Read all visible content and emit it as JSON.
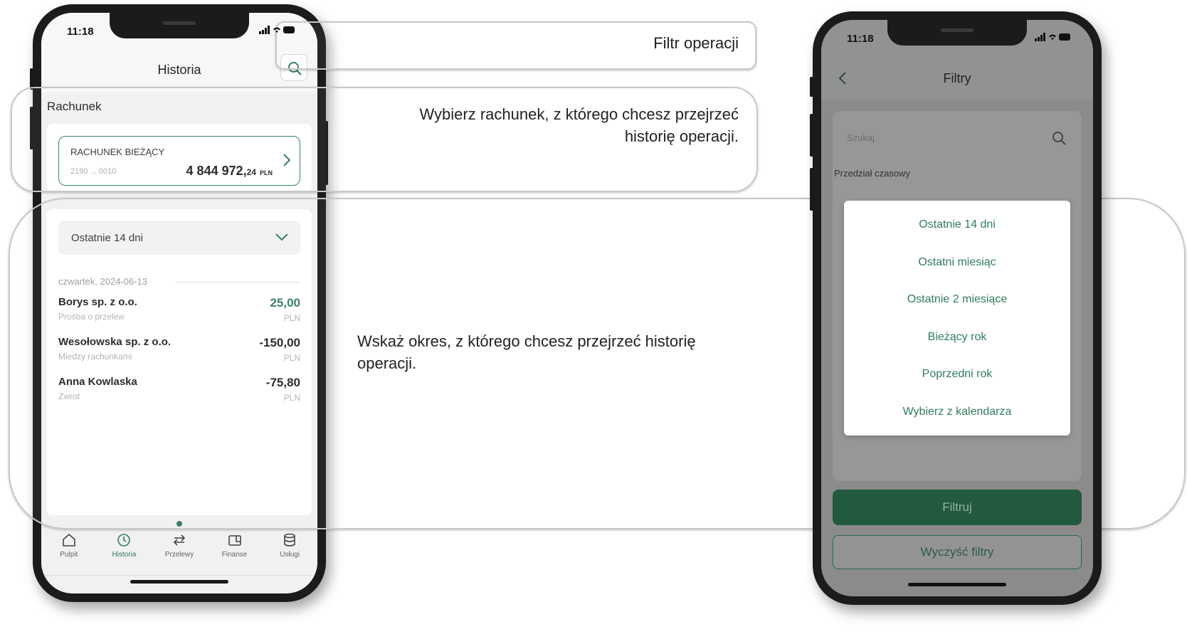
{
  "colors": {
    "brand_green": "#2e7d5b",
    "dark_green": "#225a3f",
    "overlay_gray": "#8b8b8b"
  },
  "left_phone": {
    "status_time": "11:18",
    "status_icons": "signal-icon wifi-icon battery-icon",
    "title": "Historia",
    "search_icon": "search-icon",
    "section_label": "Rachunek",
    "account": {
      "name": "RACHUNEK BIEŻĄCY",
      "number": "2190 ... 0010",
      "balance": "4 844 972,",
      "balance_fraction": "24",
      "currency": "PLN",
      "chevron_icon": "chevron-right-icon"
    },
    "period": {
      "selected": "Ostatnie 14 dni",
      "chevron_icon": "chevron-down-icon"
    },
    "date_group": "czwartek, 2024-06-13",
    "transactions": [
      {
        "name": "Borys sp. z o.o.",
        "description": "Prośba o przelew",
        "amount": "25,00",
        "currency": "PLN"
      },
      {
        "name": "Wesołowska sp. z o.o.",
        "description": "Miedzy rachunkami",
        "amount": "-150,00",
        "currency": "PLN"
      },
      {
        "name": "Anna Kowlaska",
        "description": "Zwrot",
        "amount": "-75,80",
        "currency": "PLN"
      }
    ],
    "nav": [
      {
        "label": "Pulpit",
        "icon": "home-icon"
      },
      {
        "label": "Historia",
        "icon": "history-icon"
      },
      {
        "label": "Przelewy",
        "icon": "transfer-icon"
      },
      {
        "label": "Finanse",
        "icon": "wallet-icon"
      },
      {
        "label": "Usługi",
        "icon": "database-icon"
      }
    ]
  },
  "annotations": {
    "filter": "Filtr operacji",
    "account": "Wybierz rachunek, z którego chcesz przejrzeć historię operacji.",
    "period": "Wskaż okres, z którego chcesz przejrzeć historię operacji."
  },
  "right_phone": {
    "status_time": "11:18",
    "back_icon": "chevron-left-icon",
    "title": "Filtry",
    "search_placeholder": "Szukaj",
    "range_label": "Przedział czasowy",
    "options": [
      "Ostatnie 14 dni",
      "Ostatni miesiąc",
      "Ostatnie 2 miesiące",
      "Bieżący rok",
      "Poprzedni rok",
      "Wybierz z kalendarza"
    ],
    "filter_button": "Filtruj",
    "clear_button": "Wyczyść filtry"
  }
}
